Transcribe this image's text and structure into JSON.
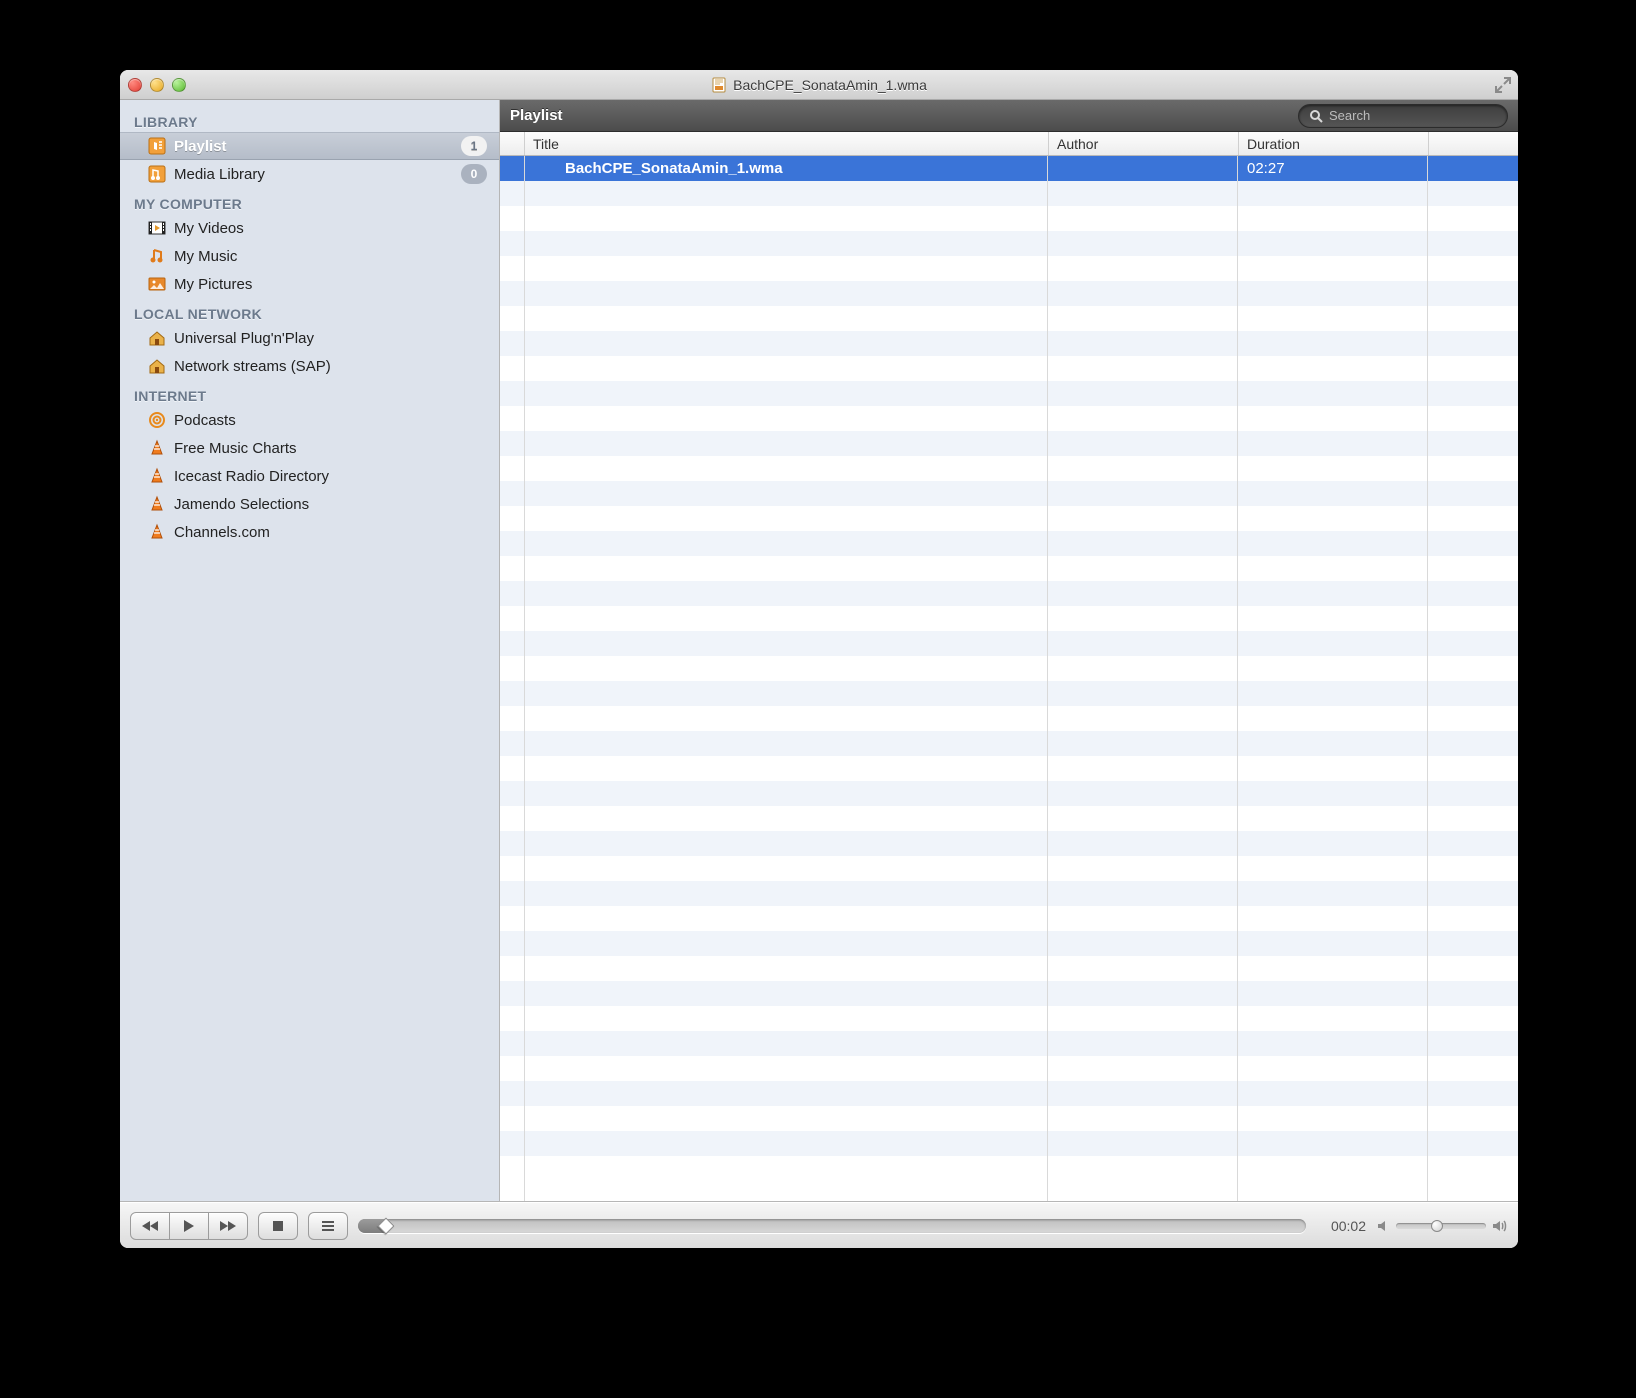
{
  "window": {
    "title": "BachCPE_SonataAmin_1.wma"
  },
  "sidebar": {
    "sections": [
      {
        "header": "LIBRARY",
        "items": [
          {
            "label": "Playlist",
            "badge": "1",
            "icon": "playlist",
            "selected": true
          },
          {
            "label": "Media Library",
            "badge": "0",
            "icon": "media-library"
          }
        ]
      },
      {
        "header": "MY COMPUTER",
        "items": [
          {
            "label": "My Videos",
            "icon": "video"
          },
          {
            "label": "My Music",
            "icon": "music"
          },
          {
            "label": "My Pictures",
            "icon": "pictures"
          }
        ]
      },
      {
        "header": "LOCAL NETWORK",
        "items": [
          {
            "label": "Universal Plug'n'Play",
            "icon": "house"
          },
          {
            "label": "Network streams (SAP)",
            "icon": "house"
          }
        ]
      },
      {
        "header": "INTERNET",
        "items": [
          {
            "label": "Podcasts",
            "icon": "podcast"
          },
          {
            "label": "Free Music Charts",
            "icon": "cone"
          },
          {
            "label": "Icecast Radio Directory",
            "icon": "cone"
          },
          {
            "label": "Jamendo Selections",
            "icon": "cone"
          },
          {
            "label": "Channels.com",
            "icon": "cone"
          }
        ]
      }
    ]
  },
  "main": {
    "panel_title": "Playlist",
    "search_placeholder": "Search",
    "columns": {
      "title": "Title",
      "author": "Author",
      "duration": "Duration"
    },
    "rows": [
      {
        "title": "BachCPE_SonataAmin_1.wma",
        "author": "",
        "duration": "02:27",
        "selected": true
      }
    ]
  },
  "playback": {
    "time": "00:02"
  }
}
